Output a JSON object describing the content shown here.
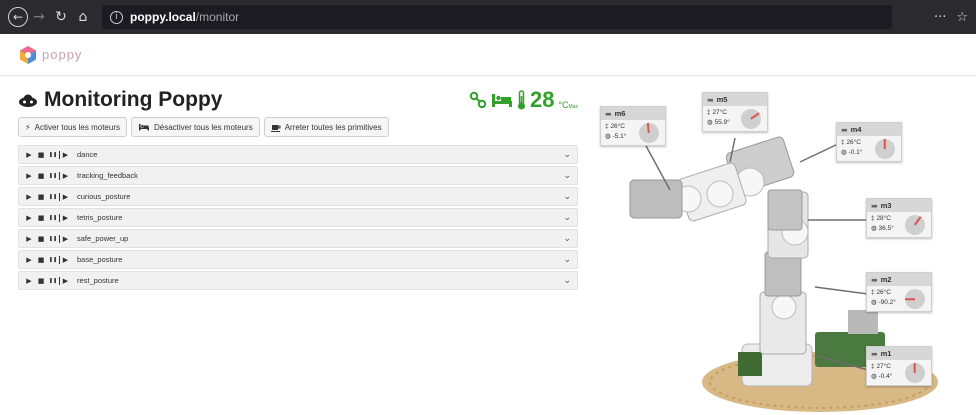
{
  "browser": {
    "url_host": "poppy.local",
    "url_path": "/monitor",
    "menu_glyph": "···",
    "star_glyph": "☆"
  },
  "app": {
    "logo_text": "poppy",
    "title": "Monitoring Poppy",
    "temperature": "28",
    "temperature_unit": "°C",
    "temperature_sub": "Max",
    "status_color": "#33a02c"
  },
  "buttons": [
    {
      "icon": "power-icon",
      "label": "Activer tous les moteurs"
    },
    {
      "icon": "bed-icon",
      "label": "Désactiver tous les moteurs"
    },
    {
      "icon": "coffee-icon",
      "label": "Arreter toutes les primitives"
    }
  ],
  "primitives": [
    {
      "name": "dance"
    },
    {
      "name": "tracking_feedback"
    },
    {
      "name": "curious_posture"
    },
    {
      "name": "tetris_posture"
    },
    {
      "name": "safe_power_up"
    },
    {
      "name": "base_posture"
    },
    {
      "name": "rest_posture"
    }
  ],
  "controls": {
    "play": "▶",
    "stop": "■",
    "pause": "❚❚",
    "step": "▶",
    "chevron": "⌄"
  },
  "motors": [
    {
      "name": "m6",
      "temp": "26°C",
      "angle": "-5.1°",
      "needle_deg": -5.1
    },
    {
      "name": "m5",
      "temp": "27°C",
      "angle": "55.9°",
      "needle_deg": 55.9
    },
    {
      "name": "m4",
      "temp": "26°C",
      "angle": "-0.1°",
      "needle_deg": -0.1
    },
    {
      "name": "m3",
      "temp": "28°C",
      "angle": "36.5°",
      "needle_deg": 36.5
    },
    {
      "name": "m2",
      "temp": "26°C",
      "angle": "-90.2°",
      "needle_deg": -90.2
    },
    {
      "name": "m1",
      "temp": "27°C",
      "angle": "-0.4°",
      "needle_deg": -0.4
    }
  ]
}
